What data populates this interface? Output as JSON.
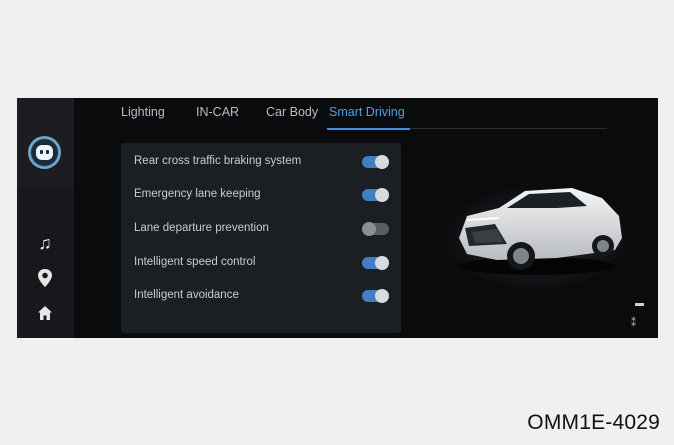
{
  "tabs": [
    {
      "label": "Lighting",
      "active": false
    },
    {
      "label": "IN-CAR",
      "active": false
    },
    {
      "label": "Car Body",
      "active": false
    },
    {
      "label": "Smart Driving",
      "active": true
    }
  ],
  "settings": [
    {
      "label": "Rear cross traffic braking system",
      "enabled": true
    },
    {
      "label": "Emergency lane keeping",
      "enabled": true
    },
    {
      "label": "Lane departure prevention",
      "enabled": false
    },
    {
      "label": "Intelligent speed control",
      "enabled": true
    },
    {
      "label": "Intelligent avoidance",
      "enabled": true
    }
  ],
  "sidebar": {
    "icons": [
      "voice-assistant-icon",
      "music-note-icon",
      "map-pin-icon",
      "home-icon"
    ]
  },
  "colors": {
    "accent": "#3d8fe0",
    "toggle_on": "#3f7fc4",
    "toggle_off": "#5a5e64"
  },
  "caption": "OMM1E-4029"
}
